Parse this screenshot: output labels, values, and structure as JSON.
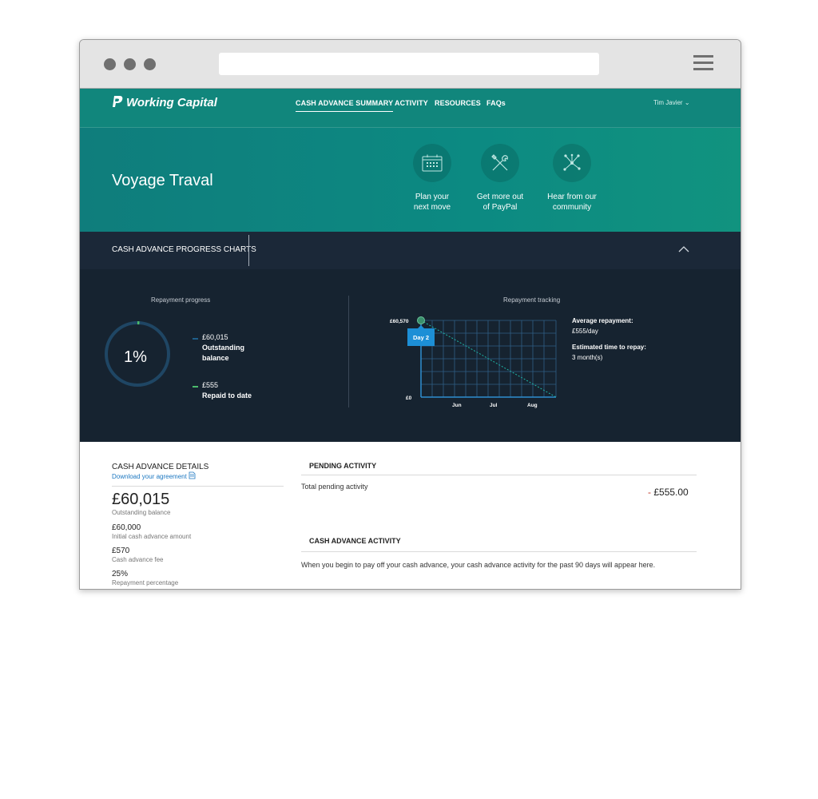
{
  "app": {
    "brand": "Working Capital",
    "nav": [
      "CASH ADVANCE SUMMARY",
      "ACTIVITY",
      "RESOURCES",
      "FAQs"
    ],
    "user": "Tim Javier"
  },
  "hero": {
    "title": "Voyage Traval",
    "items": [
      {
        "line1": "Plan your",
        "line2": "next move",
        "icon": "calendar-icon"
      },
      {
        "line1": "Get more out",
        "line2": "of PayPal",
        "icon": "tools-icon"
      },
      {
        "line1": "Hear from our",
        "line2": "community",
        "icon": "network-icon"
      }
    ]
  },
  "progress": {
    "section_title": "CASH ADVANCE PROGRESS CHARTS",
    "repayment_progress": {
      "title": "Repayment progress",
      "percent_label": "1%",
      "percent_value": 1,
      "outstanding_value": "£60,015",
      "outstanding_label_1": "Outstanding",
      "outstanding_label_2": "balance",
      "repaid_value": "£555",
      "repaid_label": "Repaid to date"
    },
    "repayment_tracking": {
      "title": "Repayment tracking",
      "top_label": "£60,570",
      "bottom_label": "£0",
      "months": [
        "Jun",
        "Jul",
        "Aug"
      ],
      "tooltip": "Day 2",
      "avg_title": "Average repayment:",
      "avg_value": "£555/day",
      "est_title": "Estimated time to repay:",
      "est_value": "3 month(s)"
    }
  },
  "details": {
    "title": "CASH ADVANCE DETAILS",
    "download_link": "Download your agreement",
    "balance": "£60,015",
    "balance_label": "Outstanding balance",
    "rows": [
      {
        "value": "£60,000",
        "label": "Initial cash advance amount"
      },
      {
        "value": "£570",
        "label": "Cash advance fee"
      },
      {
        "value": "25%",
        "label": "Repayment percentage"
      }
    ]
  },
  "pending": {
    "title": "PENDING ACTIVITY",
    "label": "Total pending activity",
    "amount_sign": "-",
    "amount": "£555.00"
  },
  "activity": {
    "title": "CASH ADVANCE ACTIVITY",
    "message": "When you begin to pay off your cash advance, your cash advance activity for the past 90 days will appear here."
  },
  "colors": {
    "brand_teal": "#11867c",
    "dark_panel": "#162330",
    "outstanding_blue": "#1f5f8b",
    "repaid_green": "#4cbb6c",
    "tooltip_blue": "#1d8fd6"
  }
}
